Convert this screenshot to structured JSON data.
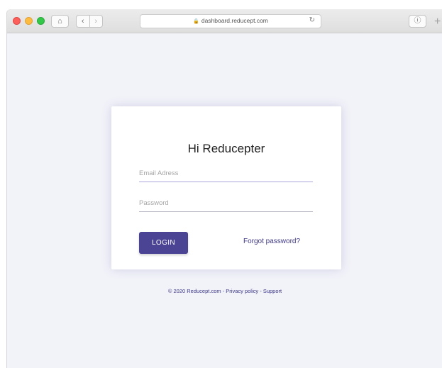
{
  "browser": {
    "url": "dashboard.reducept.com",
    "lock_icon": "lock-icon",
    "home_icon": "home-icon",
    "back_icon": "chevron-left-icon",
    "forward_icon": "chevron-right-icon",
    "reload_icon": "reload-icon",
    "info_icon": "info-icon",
    "new_tab_icon": "plus-icon",
    "glyphs": {
      "home": "⌂",
      "back": "‹",
      "forward": "›",
      "lock": "🔒",
      "reload": "↻",
      "info": "ⓘ",
      "plus": "+"
    }
  },
  "login": {
    "title": "Hi Reducepter",
    "email_placeholder": "Email Adress",
    "password_placeholder": "Password",
    "login_label": "LOGIN",
    "forgot_label": "Forgot password?"
  },
  "footer": {
    "copyright": "© 2020 Reducept.com",
    "sep1": " - ",
    "privacy": "Privacy policy",
    "sep2": " - ",
    "support": "Support"
  },
  "colors": {
    "page_bg": "#f2f3f9",
    "accent": "#4b4394",
    "link": "#3d3785"
  }
}
